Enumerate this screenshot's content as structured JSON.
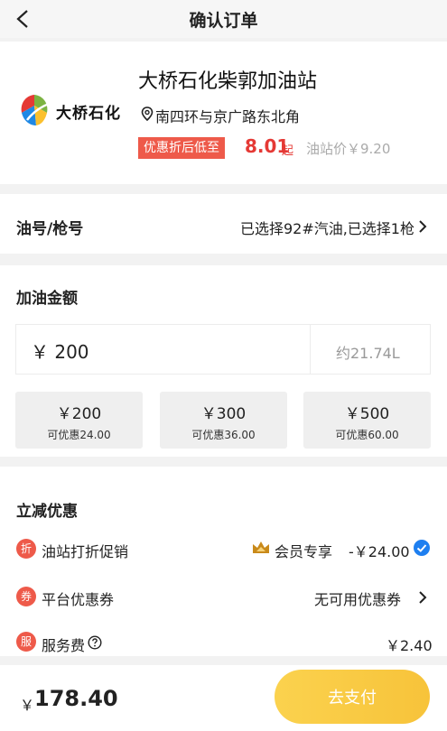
{
  "header": {
    "title": "确认订单"
  },
  "station": {
    "logo_text": "大桥石化",
    "name": "大桥石化柴郭加油站",
    "address": "南四环与京广路东北角",
    "promo_label": "优惠折后低至",
    "promo_price": "8.01",
    "promo_suffix": "起",
    "station_price": "油站价￥9.20"
  },
  "oil": {
    "label": "油号/枪号",
    "value": "已选择92#汽油,已选择1枪"
  },
  "amount": {
    "label": "加油金额",
    "input_value": "￥ 200",
    "liters": "约21.74L",
    "quick_options": [
      {
        "amount": "￥200",
        "discount": "可优惠24.00"
      },
      {
        "amount": "￥300",
        "discount": "可优惠36.00"
      },
      {
        "amount": "￥500",
        "discount": "可优惠60.00"
      }
    ]
  },
  "discount": {
    "label": "立减优惠",
    "items": [
      {
        "icon": "折",
        "label": "油站打折促销",
        "member": "会员专享",
        "value": "-￥24.00"
      },
      {
        "icon": "券",
        "label": "平台优惠券",
        "value": "无可用优惠券"
      },
      {
        "icon": "服",
        "label": "服务费",
        "value": "￥2.40"
      }
    ]
  },
  "footer": {
    "currency": "￥",
    "total": "178.40",
    "pay_label": "去支付"
  },
  "colors": {
    "accent_red": "#ee5a4a",
    "pay_yellow": "#fbd24e",
    "check_blue": "#1e7ff0"
  }
}
